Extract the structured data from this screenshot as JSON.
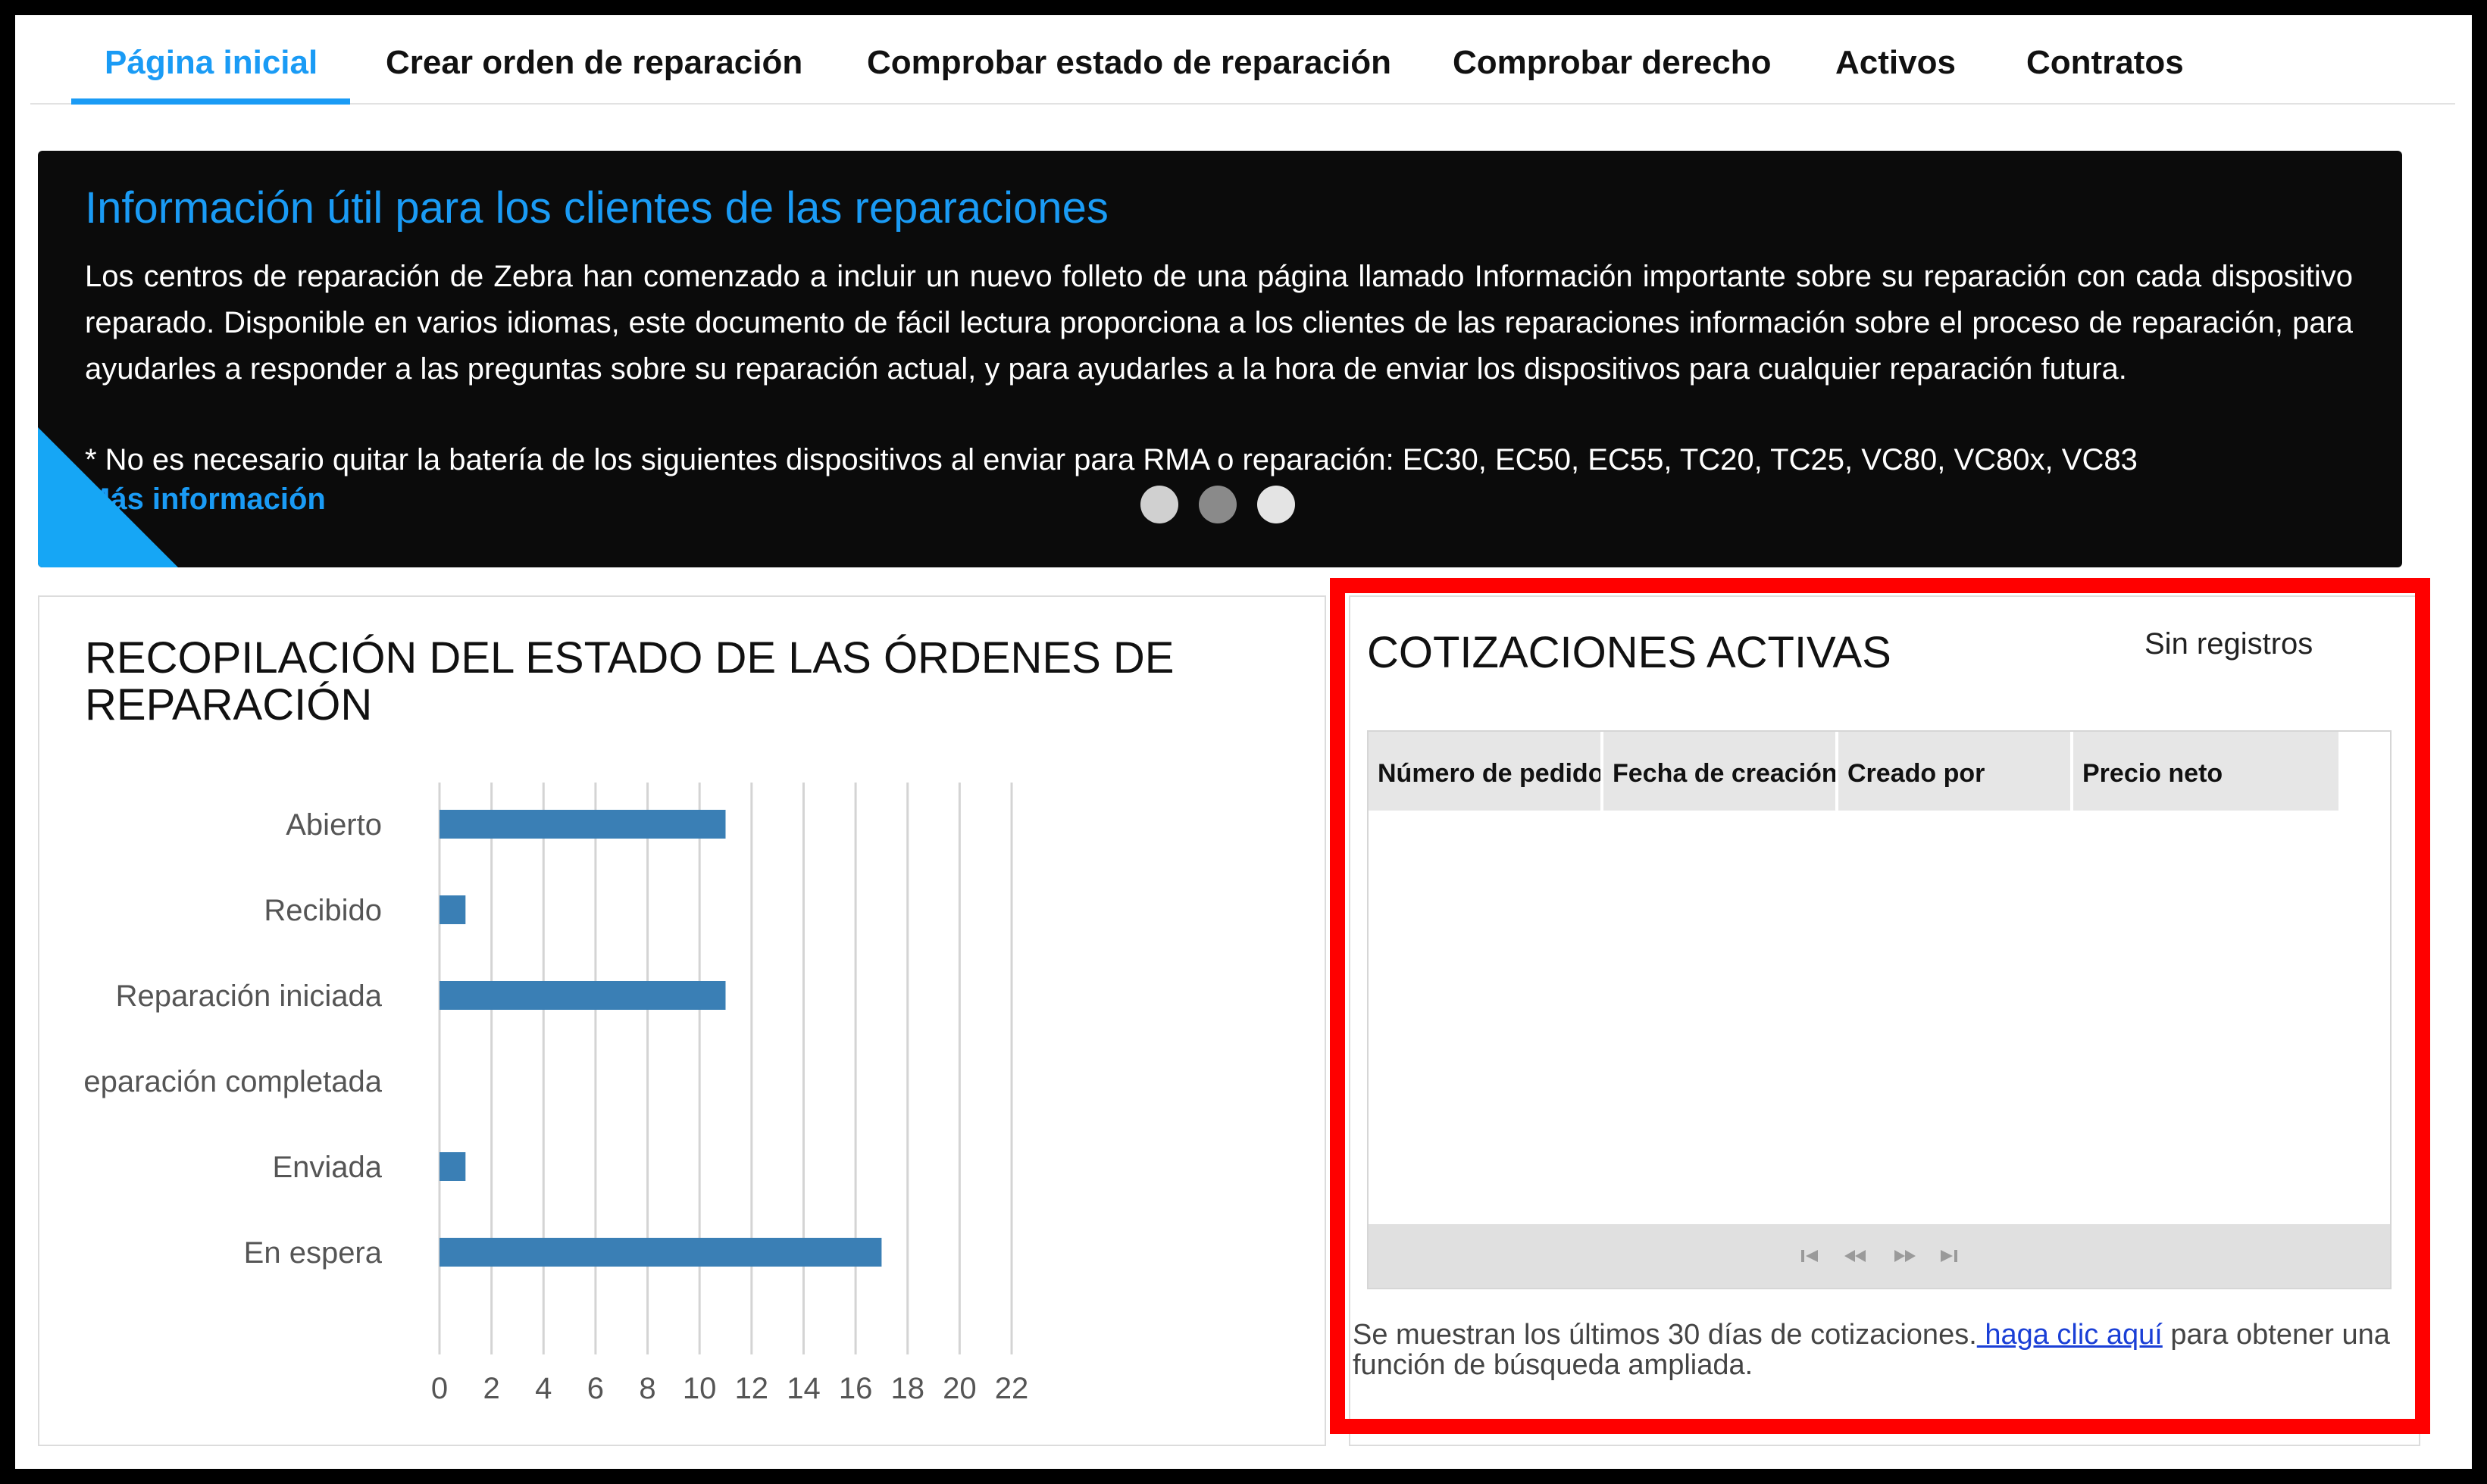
{
  "nav": {
    "items": [
      {
        "label": "Página inicial",
        "active": true
      },
      {
        "label": "Crear orden de reparación",
        "active": false
      },
      {
        "label": "Comprobar estado de reparación",
        "active": false
      },
      {
        "label": "Comprobar derecho",
        "active": false
      },
      {
        "label": "Activos",
        "active": false
      },
      {
        "label": "Contratos",
        "active": false
      }
    ]
  },
  "banner": {
    "title": "Información útil para los clientes de las reparaciones",
    "body": "Los centros de reparación de Zebra han comenzado a incluir un nuevo folleto de una página llamado Información importante sobre su reparación con cada dispositivo reparado. Disponible en varios idiomas, este documento de fácil lectura proporciona a los clientes de las reparaciones información sobre el proceso de reparación, para ayudarles a responder a las preguntas sobre su reparación actual, y para ayudarles a la hora de enviar los dispositivos para cualquier reparación futura.",
    "note": "* No es necesario quitar la batería de los siguientes dispositivos al enviar para RMA o reparación: EC30, EC50, EC55, TC20, TC25, VC80, VC80x, VC83",
    "link_label": "Más información",
    "dots": [
      {
        "color": "#d0d0d0"
      },
      {
        "color": "#8a8a8a"
      },
      {
        "color": "#e4e4e4"
      }
    ]
  },
  "summary": {
    "title": "RECOPILACIÓN DEL ESTADO DE LAS ÓRDENES DE REPARACIÓN"
  },
  "chart_data": {
    "type": "bar",
    "orientation": "horizontal",
    "title": "RECOPILACIÓN DEL ESTADO DE LAS ÓRDENES DE REPARACIÓN",
    "categories": [
      "Abierto",
      "Recibido",
      "Reparación iniciada",
      "Reparación completada",
      "Enviada",
      "En espera"
    ],
    "values": [
      11,
      1,
      11,
      0,
      1,
      17
    ],
    "xlim": [
      0,
      22
    ],
    "xticks": [
      "0",
      "2",
      "4",
      "6",
      "8",
      "10",
      "12",
      "14",
      "16",
      "18",
      "20",
      "22"
    ],
    "xlabel": "",
    "ylabel": "",
    "grid": true,
    "bar_color": "#3a7fb5"
  },
  "quotes": {
    "title": "COTIZACIONES ACTIVAS",
    "no_records": "Sin registros",
    "columns": [
      "Número de pedido",
      "Fecha de creación",
      "Creado por",
      "Precio neto"
    ],
    "rows": [],
    "pager": [
      "first-page-icon",
      "previous-page-icon",
      "next-page-icon",
      "last-page-icon"
    ],
    "note_before": "Se muestran los últimos 30 días de cotizaciones.",
    "note_link": " haga clic aquí",
    "note_after": " para obtener una función de búsqueda ampliada."
  },
  "highlight_color": "#ff0000"
}
